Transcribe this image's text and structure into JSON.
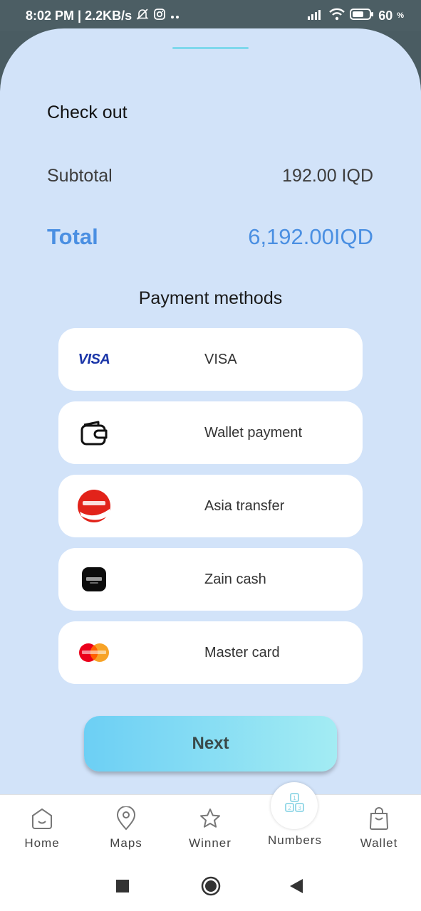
{
  "status": {
    "time_info": "8:02 PM | 2.2KB/s",
    "battery": "60"
  },
  "checkout": {
    "title": "Check out",
    "subtotal_label": "Subtotal",
    "subtotal_value": "192.00 IQD",
    "total_label": "Total",
    "total_value": "6,192.00IQD"
  },
  "payment": {
    "title": "Payment methods",
    "methods": [
      {
        "label": "VISA",
        "icon": "visa-logo-icon"
      },
      {
        "label": "Wallet payment",
        "icon": "wallet-icon"
      },
      {
        "label": "Asia transfer",
        "icon": "asiacell-logo-icon"
      },
      {
        "label": "Zain cash",
        "icon": "zain-cash-logo-icon"
      },
      {
        "label": "Master card",
        "icon": "mastercard-logo-icon"
      }
    ],
    "visa_logo_text": "VISA"
  },
  "next_button": "Next",
  "nav": {
    "home": "Home",
    "maps": "Maps",
    "winner": "Winner",
    "numbers": "Numbers",
    "wallet": "Wallet"
  },
  "colors": {
    "sheet_bg": "#d2e3f9",
    "accent": "#4a8fe2",
    "button_gradient_start": "#6ccff4",
    "button_gradient_end": "#a3ecf3"
  }
}
